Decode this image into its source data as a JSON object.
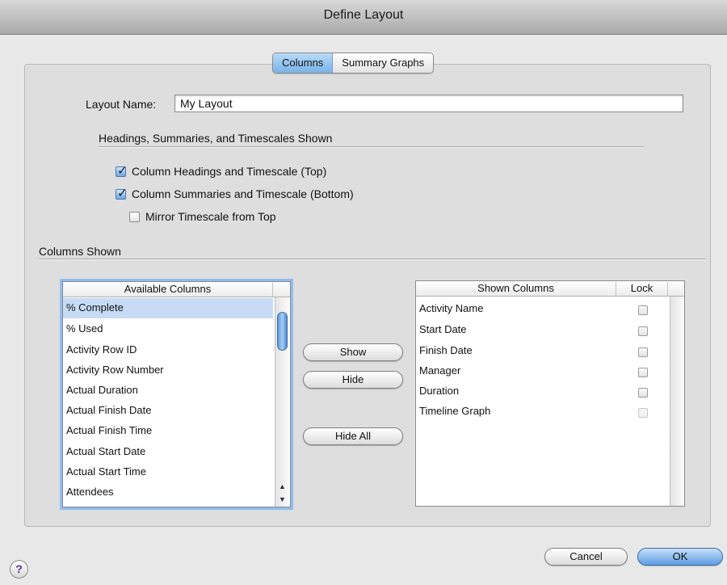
{
  "window": {
    "title": "Define Layout"
  },
  "tabs": [
    {
      "label": "Columns",
      "selected": true
    },
    {
      "label": "Summary Graphs",
      "selected": false
    }
  ],
  "layout_name": {
    "label": "Layout Name:",
    "value": "My Layout"
  },
  "headings_section": {
    "title": "Headings, Summaries, and Timescales Shown",
    "options": [
      {
        "label": "Column Headings and Timescale (Top)",
        "checked": true
      },
      {
        "label": "Column Summaries and Timescale (Bottom)",
        "checked": true
      },
      {
        "label": "Mirror Timescale from Top",
        "checked": false
      }
    ]
  },
  "columns_section": {
    "title": "Columns Shown"
  },
  "available_columns": {
    "header": "Available Columns",
    "items": [
      "% Complete",
      "% Used",
      "Activity Row ID",
      "Activity Row Number",
      "Actual Duration",
      "Actual Finish Date",
      "Actual Finish Time",
      "Actual Start Date",
      "Actual Start Time",
      "Attendees"
    ],
    "selected_index": 0
  },
  "buttons": {
    "show": "Show",
    "hide": "Hide",
    "hide_all": "Hide All",
    "cancel": "Cancel",
    "ok": "OK",
    "help": "?"
  },
  "shown_columns": {
    "header": "Shown Columns",
    "lock_header": "Lock",
    "items": [
      {
        "name": "Activity Name",
        "locked": false
      },
      {
        "name": "Start Date",
        "locked": false
      },
      {
        "name": "Finish Date",
        "locked": false
      },
      {
        "name": "Manager",
        "locked": false
      },
      {
        "name": "Duration",
        "locked": false
      },
      {
        "name": "Timeline Graph",
        "locked": false
      }
    ]
  },
  "colors": {
    "accent": "#6fa8e6",
    "selection": "#c7dbf5",
    "focus_ring": "#8fbdf0"
  }
}
